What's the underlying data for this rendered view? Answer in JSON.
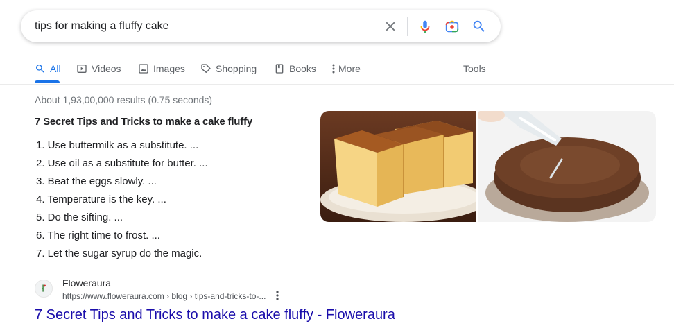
{
  "search": {
    "query": "tips for making a fluffy cake"
  },
  "tabs": [
    {
      "label": "All",
      "icon": "search-icon",
      "active": true
    },
    {
      "label": "Videos",
      "icon": "play-icon"
    },
    {
      "label": "Images",
      "icon": "image-icon"
    },
    {
      "label": "Shopping",
      "icon": "tag-icon"
    },
    {
      "label": "Books",
      "icon": "book-icon"
    },
    {
      "label": "More",
      "icon": "more-vert-icon"
    }
  ],
  "tools_label": "Tools",
  "result_stats": "About 1,93,00,000 results (0.75 seconds)",
  "featured_snippet": {
    "title": "7 Secret Tips and Tricks to make a cake fluffy",
    "items": [
      "1. Use buttermilk as a substitute. ...",
      "2. Use oil as a substitute for butter. ...",
      "3. Beat the eggs slowly. ...",
      "4. Temperature is the key. ...",
      "5. Do the sifting. ...",
      "6. The right time to frost. ...",
      "7. Let the sugar syrup do the magic."
    ]
  },
  "result": {
    "site_name": "Floweraura",
    "url": "https://www.floweraura.com › blog › tips-and-tricks-to-...",
    "title": "7 Secret Tips and Tricks to make a cake fluffy - Floweraura"
  },
  "colors": {
    "accent": "#1a73e8",
    "link": "#1a0dab",
    "text": "#202124",
    "muted": "#70757a"
  }
}
